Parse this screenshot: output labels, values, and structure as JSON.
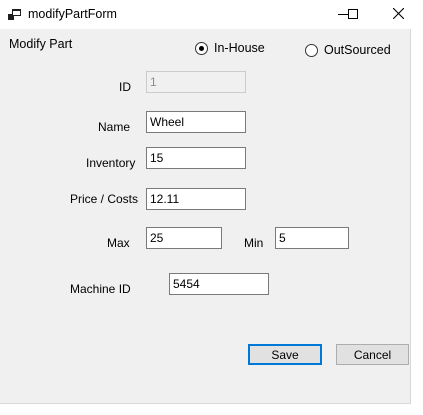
{
  "window": {
    "title": "modifyPartForm"
  },
  "titlebar_icons": {
    "app": "form-app-icon",
    "minimize": "minimize-icon",
    "maximize": "maximize-icon",
    "close": "close-icon"
  },
  "header": {
    "label": "Modify Part"
  },
  "source": {
    "options": [
      {
        "label": "In-House",
        "checked": true
      },
      {
        "label": "OutSourced",
        "checked": false
      }
    ]
  },
  "fields": {
    "id": {
      "label": "ID",
      "value": "1",
      "enabled": false
    },
    "name": {
      "label": "Name",
      "value": "Wheel"
    },
    "inventory": {
      "label": "Inventory",
      "value": "15"
    },
    "price": {
      "label": "Price / Costs",
      "value": "12.11"
    },
    "max": {
      "label": "Max",
      "value": "25"
    },
    "min": {
      "label": "Min",
      "value": "5"
    },
    "machine_id": {
      "label": "Machine ID",
      "value": "5454"
    }
  },
  "buttons": {
    "save": "Save",
    "cancel": "Cancel"
  },
  "colors": {
    "form_background": "#f0f0f0",
    "titlebar": "#ffffff",
    "default_button_border": "#0078d7"
  }
}
